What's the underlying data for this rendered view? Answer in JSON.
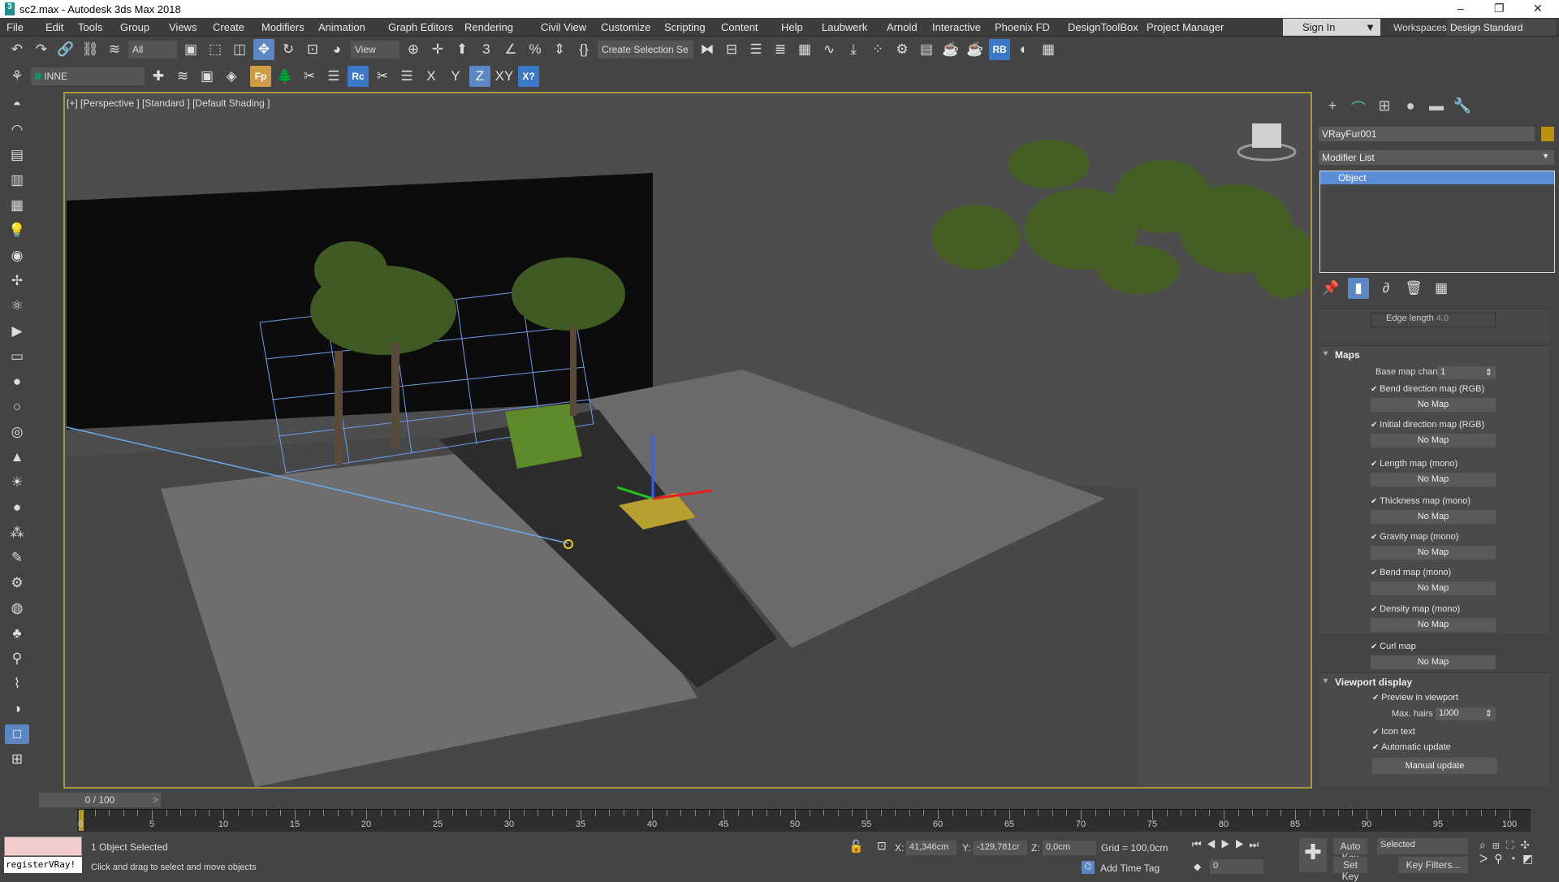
{
  "window": {
    "title": "sc2.max - Autodesk 3ds Max 2018",
    "app_icon": "3",
    "min": "–",
    "max": "❐",
    "close": "✕"
  },
  "menu": [
    "File",
    "Edit",
    "Tools",
    "Group",
    "Views",
    "Create",
    "Modifiers",
    "Animation",
    "Graph Editors",
    "Rendering",
    "Civil View",
    "Customize",
    "Scripting",
    "Content",
    "Help",
    "Laubwerk",
    "Arnold",
    "Interactive",
    "Phoenix FD",
    "DesignToolBox",
    "Project Manager"
  ],
  "signin": "Sign In",
  "workspaces_label": "Workspaces:",
  "workspace": "Design Standard",
  "toolbar1": {
    "filter": "All",
    "refcoord": "View",
    "selection_set": "Create Selection Se",
    "icons_a": [
      [
        "undo-icon",
        "↶"
      ],
      [
        "redo-icon",
        "↷"
      ],
      [
        "link-icon",
        "🔗"
      ],
      [
        "unlink-icon",
        "⛓"
      ],
      [
        "bind-spacewarp-icon",
        "≋"
      ]
    ],
    "icons_b": [
      [
        "select-object-icon",
        "▣"
      ],
      [
        "rect-select-icon",
        "⬚"
      ],
      [
        "window-crossing-icon",
        "◫"
      ],
      [
        "move-icon",
        "✥",
        1
      ],
      [
        "rotate-icon",
        "↻"
      ],
      [
        "scale-icon",
        "⊡"
      ],
      [
        "placement-icon",
        "◕"
      ]
    ],
    "icons_c": [
      [
        "pivot-icon",
        "⊕"
      ],
      [
        "manipulate-icon",
        "✛"
      ],
      [
        "keyboard-shortcut-icon",
        "⬆"
      ],
      [
        "snap-3d-icon",
        "3"
      ],
      [
        "angle-snap-icon",
        "∠"
      ],
      [
        "percent-snap-icon",
        "%"
      ],
      [
        "spinner-snap-icon",
        "⇕"
      ],
      [
        "edit-named-sel-icon",
        "{}"
      ]
    ],
    "icons_d": [
      [
        "mirror-icon",
        "⧓"
      ],
      [
        "align-icon",
        "⊟"
      ],
      [
        "scene-explorer-icon",
        "☰"
      ],
      [
        "layer-explorer-icon",
        "≣"
      ],
      [
        "toggle-ribbon-icon",
        "▦"
      ],
      [
        "curve-editor-icon",
        "∿"
      ],
      [
        "schematic-icon",
        "⤓"
      ],
      [
        "material-editor-icon",
        "⁘"
      ],
      [
        "render-setup-icon",
        "⚙"
      ],
      [
        "rendered-frame-icon",
        "▤"
      ],
      [
        "render-icon",
        "☕"
      ],
      [
        "render-iterative-icon",
        "☕"
      ],
      [
        "rb-icon",
        "RB",
        2
      ],
      [
        "material-icon",
        "◐"
      ],
      [
        "grid-icon",
        "▦"
      ]
    ]
  },
  "toolbar2": {
    "layer": "INNE",
    "icons_a": [
      [
        "layer-manager-icon",
        "⚘"
      ]
    ],
    "icons_b": [
      [
        "add-layer-icon",
        "✚"
      ],
      [
        "layers-icon",
        "≋"
      ],
      [
        "select-layer-icon",
        "▣"
      ],
      [
        "layer-stack-icon",
        "◈"
      ]
    ],
    "icons_c": [
      [
        "fp-icon",
        "Fp",
        3
      ],
      [
        "forest-icon",
        "🌲"
      ],
      [
        "tools-icon",
        "✂"
      ],
      [
        "list-icon",
        "☰"
      ],
      [
        "rc-icon",
        "Rc",
        2
      ],
      [
        "tools2-icon",
        "✂"
      ],
      [
        "list2-icon",
        "☰"
      ],
      [
        "axis-x-icon",
        "X"
      ],
      [
        "axis-y-icon",
        "Y"
      ],
      [
        "axis-z-icon",
        "Z",
        1
      ],
      [
        "axis-xy-icon",
        "XY"
      ],
      [
        "axis-constraint-icon",
        "X?",
        2
      ]
    ]
  },
  "leftstrip": [
    [
      "teapot-icon",
      "◓"
    ],
    [
      "sphere-icon",
      "◠"
    ],
    [
      "box-icon",
      "▤"
    ],
    [
      "panel-icon",
      "▥"
    ],
    [
      "panel2-icon",
      "▦"
    ],
    [
      "light-icon",
      "💡"
    ],
    [
      "camera-icon",
      "◉"
    ],
    [
      "helper-icon",
      "✢"
    ],
    [
      "fx-icon",
      "⚛"
    ],
    [
      "video-icon",
      "▶"
    ],
    [
      "shape-icon",
      "▭"
    ],
    [
      "geosphere-icon",
      "●"
    ],
    [
      "sphere2-icon",
      "○"
    ],
    [
      "torus-icon",
      "◎"
    ],
    [
      "cone-icon",
      "▲"
    ],
    [
      "sun-icon",
      "☀"
    ],
    [
      "ball-icon",
      "●"
    ],
    [
      "particles-icon",
      "⁂"
    ],
    [
      "paint-icon",
      "✎"
    ],
    [
      "ik-icon",
      "⚙"
    ],
    [
      "globe-icon",
      "◍"
    ],
    [
      "plant-icon",
      "♣"
    ],
    [
      "walk-icon",
      "⚲"
    ],
    [
      "hair-icon",
      "⌇"
    ],
    [
      "shading-icon",
      "◑"
    ],
    [
      "viewport-single-icon",
      "□"
    ],
    [
      "viewport-grid-icon",
      "⊞"
    ]
  ],
  "viewport": {
    "label": "[+] [Perspective ] [Standard ] [Default Shading ]"
  },
  "panel": {
    "tabs": [
      [
        "create-tab-icon",
        "+"
      ],
      [
        "modify-tab-icon",
        "⌒"
      ],
      [
        "hierarchy-tab-icon",
        "⊞"
      ],
      [
        "motion-tab-icon",
        "●"
      ],
      [
        "display-tab-icon",
        "▬"
      ],
      [
        "utilities-tab-icon",
        "🔧"
      ]
    ],
    "object_name": "VRayFur001",
    "object_color": "#b8900c",
    "modifier_list": "Modifier List",
    "stack_item": "Object",
    "stack_buttons": [
      [
        "pin-stack-icon",
        "📌"
      ],
      [
        "show-end-result-icon",
        "▮"
      ],
      [
        "make-unique-icon",
        "∂"
      ],
      [
        "remove-modifier-icon",
        "🗑"
      ],
      [
        "configure-sets-icon",
        "▦"
      ]
    ],
    "edge_length": "Edge length",
    "edge_value": "4.0",
    "maps": {
      "title": "Maps",
      "base_label": "Base map chan",
      "base_value": "1",
      "no_map": "No Map",
      "items": [
        "Bend direction map (RGB)",
        "Initial direction map (RGB)",
        "Length map (mono)",
        "Thickness map (mono)",
        "Gravity map (mono)",
        "Bend map (mono)",
        "Density map (mono)",
        "Curl map"
      ]
    },
    "viewport_display": {
      "title": "Viewport display",
      "preview": "Preview in viewport",
      "max_hairs_label": "Max. hairs",
      "max_hairs": "1000",
      "icon_text": "Icon text",
      "auto_update": "Automatic update",
      "manual_update": "Manual update"
    }
  },
  "timeline": {
    "slider": "0 / 100",
    "prev": "<",
    "next": ">",
    "ticks": [
      0,
      5,
      10,
      15,
      20,
      25,
      30,
      35,
      40,
      45,
      50,
      55,
      60,
      65,
      70,
      75,
      80,
      85,
      90,
      95,
      100
    ]
  },
  "status": {
    "maxscript_output": "registerVRay!",
    "selected": "1 Object Selected",
    "prompt": "Click and drag to select and move objects",
    "x_label": "X:",
    "x": "41,346cm",
    "y_label": "Y:",
    "y": "-129,781cr",
    "z_label": "Z:",
    "z": "0,0cm",
    "grid": "Grid = 100,0cm",
    "add_time_tag": "Add Time Tag",
    "auto_key": "Auto Key",
    "set_key": "Set Key",
    "key_mode": "Selected",
    "key_filters": "Key Filters...",
    "frame": "0"
  }
}
